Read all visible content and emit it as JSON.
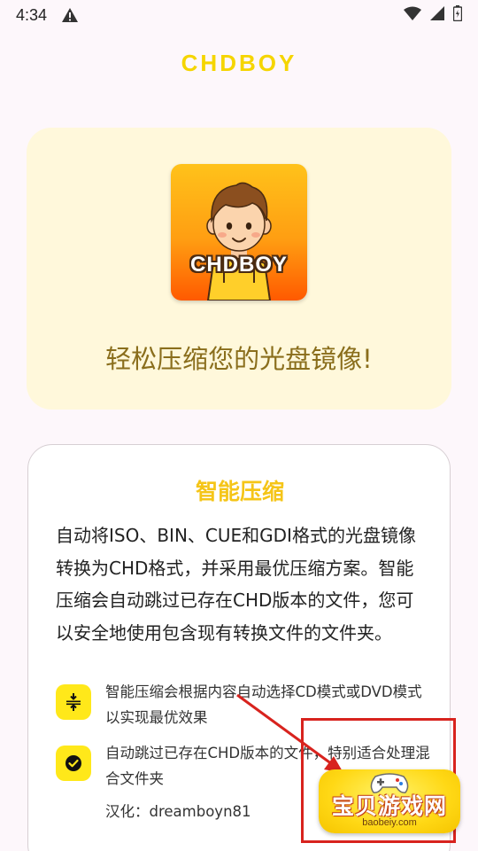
{
  "status_bar": {
    "time": "4:34",
    "icons": [
      "warning-icon",
      "wifi-icon",
      "signal-icon",
      "battery-icon"
    ]
  },
  "app": {
    "title": "CHDBOY"
  },
  "hero": {
    "logo_text": "CHDBOY",
    "slogan": "轻松压缩您的光盘镜像!"
  },
  "feature": {
    "title": "智能压缩",
    "description": "自动将ISO、BIN、CUE和GDI格式的光盘镜像转换为CHD格式，并采用最优压缩方案。智能压缩会自动跳过已存在CHD版本的文件，您可以安全地使用包含现有转换文件的文件夹。",
    "items": [
      {
        "icon": "compress-icon",
        "text": "智能压缩会根据内容自动选择CD模式或DVD模式以实现最优效果"
      },
      {
        "icon": "check-circle-icon",
        "text": "自动跳过已存在CHD版本的文件，特别适合处理混合文件夹"
      }
    ],
    "credit": "汉化：dreamboyn81"
  },
  "watermark": {
    "text": "宝贝游戏网",
    "domain": "baobeiy.com"
  },
  "colors": {
    "accent_yellow": "#f5d500",
    "hero_bg": "#fff8db",
    "slogan": "#8a6e1c",
    "icon_bg": "#ffe81a",
    "annotation_red": "#d8231e"
  }
}
